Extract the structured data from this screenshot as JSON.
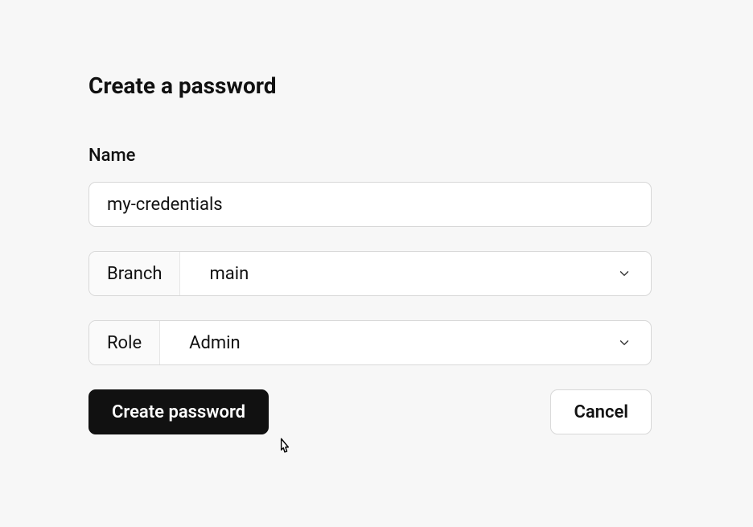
{
  "form": {
    "title": "Create a password",
    "name_label": "Name",
    "name_value": "my-credentials",
    "branch_label": "Branch",
    "branch_value": "main",
    "role_label": "Role",
    "role_value": "Admin",
    "submit_label": "Create password",
    "cancel_label": "Cancel"
  }
}
